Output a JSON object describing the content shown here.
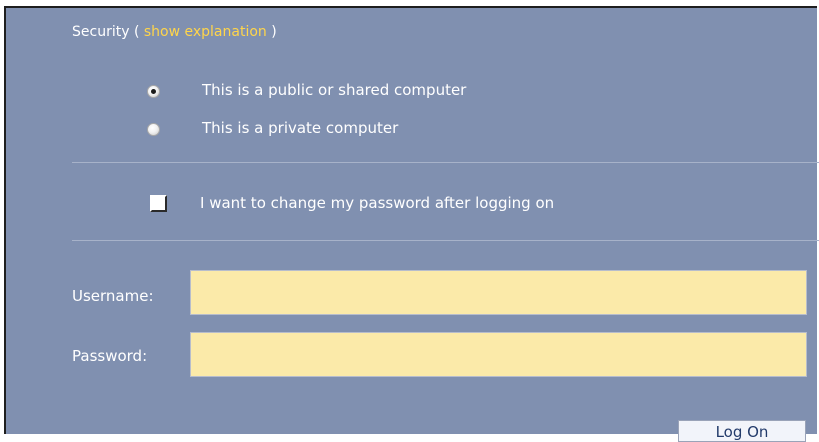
{
  "security": {
    "prefix": "Security ( ",
    "link": "show explanation",
    "suffix": " )"
  },
  "computer_type": {
    "options": [
      {
        "label": "This is a public or shared computer",
        "selected": true
      },
      {
        "label": "This is a private computer",
        "selected": false
      }
    ]
  },
  "change_password": {
    "label": "I want to change my password after logging on",
    "checked": false
  },
  "username": {
    "label": "Username:",
    "value": ""
  },
  "password": {
    "label": "Password:",
    "value": ""
  },
  "logon_button": {
    "label": "Log On"
  },
  "colors": {
    "panel_background": "#8090b0",
    "link": "#ffd54a",
    "input_background": "#fbeaa9"
  }
}
